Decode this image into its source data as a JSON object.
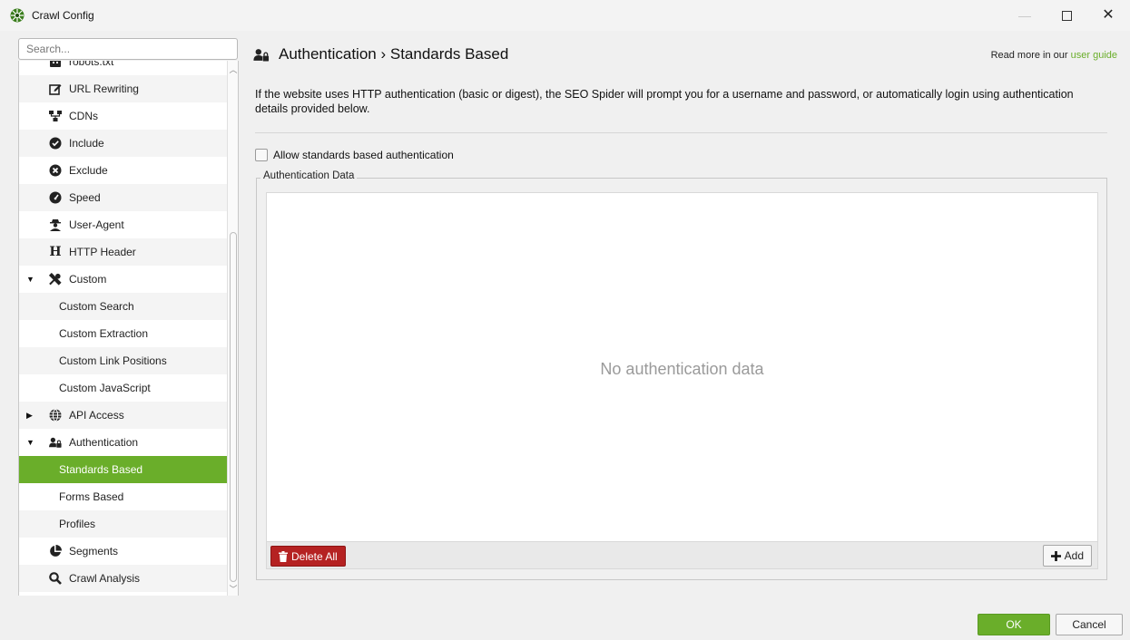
{
  "window": {
    "title": "Crawl Config",
    "controls": {
      "minimize": "—",
      "close": "✕"
    }
  },
  "sidebar": {
    "search_placeholder": "Search...",
    "items": [
      {
        "label": "robots.txt",
        "icon": "robot-icon"
      },
      {
        "label": "URL Rewriting",
        "icon": "edit-icon"
      },
      {
        "label": "CDNs",
        "icon": "sitemap-icon"
      },
      {
        "label": "Include",
        "icon": "check-circle-icon"
      },
      {
        "label": "Exclude",
        "icon": "x-circle-icon"
      },
      {
        "label": "Speed",
        "icon": "gauge-icon"
      },
      {
        "label": "User-Agent",
        "icon": "user-secret-icon"
      },
      {
        "label": "HTTP Header",
        "icon": "heading-icon"
      },
      {
        "label": "Custom",
        "icon": "tools-icon",
        "expanded": true
      },
      {
        "label": "Custom Search"
      },
      {
        "label": "Custom Extraction"
      },
      {
        "label": "Custom Link Positions"
      },
      {
        "label": "Custom JavaScript"
      },
      {
        "label": "API Access",
        "icon": "globe-icon",
        "expanded": false
      },
      {
        "label": "Authentication",
        "icon": "user-lock-icon",
        "expanded": true
      },
      {
        "label": "Standards Based",
        "selected": true
      },
      {
        "label": "Forms Based"
      },
      {
        "label": "Profiles"
      },
      {
        "label": "Segments",
        "icon": "pie-chart-icon"
      },
      {
        "label": "Crawl Analysis",
        "icon": "search-icon"
      }
    ]
  },
  "main": {
    "breadcrumb": "Authentication › Standards Based",
    "guide_prefix": "Read more in our",
    "guide_link": "user guide",
    "description": "If the website uses HTTP authentication (basic or digest), the SEO Spider will prompt you for a username and password, or automatically login using authentication details provided below.",
    "checkbox": {
      "label": "Allow standards based authentication",
      "checked": false
    },
    "group_title": "Authentication Data",
    "empty_message": "No authentication data",
    "delete_all_label": "Delete All",
    "add_label": "Add"
  },
  "footer": {
    "ok_label": "OK",
    "cancel_label": "Cancel"
  },
  "colors": {
    "accent": "#6aae2a",
    "danger": "#b52222"
  }
}
